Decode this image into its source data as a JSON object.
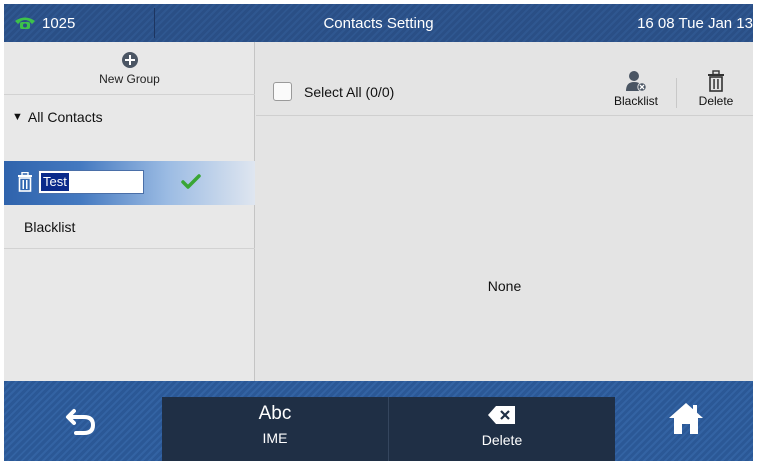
{
  "status": {
    "extension": "1025",
    "title": "Contacts Setting",
    "datetime": "16 08 Tue Jan 13"
  },
  "left": {
    "new_group_label": "New Group",
    "all_contacts_label": "All Contacts",
    "editing_group_value": "Test",
    "blacklist_label": "Blacklist"
  },
  "right": {
    "select_all_label": "Select All (0/0)",
    "blacklist_button_label": "Blacklist",
    "delete_button_label": "Delete",
    "empty_text": "None"
  },
  "softkeys": {
    "ime_top": "Abc",
    "ime_bottom": "IME",
    "delete_label": "Delete"
  },
  "icons": {
    "phone": "phone-icon",
    "plus": "plus-circle-icon",
    "trash": "trash-icon",
    "check": "checkmark-icon",
    "blacklist": "blacklist-person-icon",
    "back": "back-arrow-icon",
    "backspace": "backspace-icon",
    "home": "home-icon"
  },
  "colors": {
    "accent_green": "#3aa635",
    "selection_blue": "#2f63ac",
    "status_bar": "#2a4f86"
  }
}
